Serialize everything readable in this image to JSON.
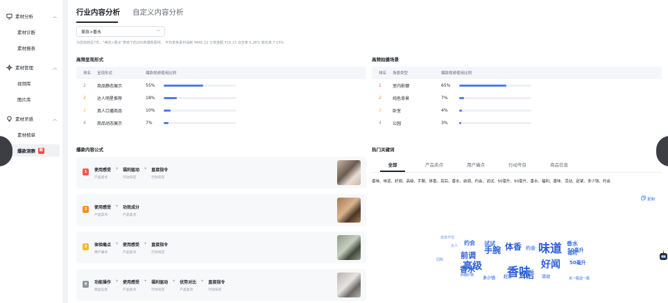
{
  "sidebar": {
    "groups": [
      {
        "label": "素材分析",
        "icon": "monitor-icon",
        "items": [
          "素材诊断",
          "素材报表"
        ]
      },
      {
        "label": "素材管理",
        "icon": "cross-icon",
        "items": [
          "视频库",
          "图片库"
        ]
      },
      {
        "label": "素材灵感",
        "icon": "bulb-icon",
        "items": [
          "素材榜单",
          "爆款洞察"
        ]
      }
    ],
    "active_item": "爆款洞察",
    "new_badge": "新"
  },
  "tabs": [
    "行业内容分析",
    "自定义内容分析"
  ],
  "filter": {
    "selected": "美妆>香水"
  },
  "summary": "为您找到近7天，\"美妆>香水\"类目下的200条爆款素材。  平均单条素材消耗 ¥845.22  订单金额 ¥10.13  点击率 5.26%  转化率 7.15%",
  "presentation": {
    "title": "高频呈现形式",
    "headers": [
      "排名",
      "呈现形式",
      "爆款视频使用比例"
    ],
    "rows": [
      {
        "rank": "1",
        "name": "商品静态展示",
        "pct": "55%",
        "value": 0.55
      },
      {
        "rank": "2",
        "name": "达人明星推荐",
        "pct": "18%",
        "value": 0.18
      },
      {
        "rank": "3",
        "name": "真人口播商品",
        "pct": "10%",
        "value": 0.1
      },
      {
        "rank": "4",
        "name": "商品动态展示",
        "pct": "7%",
        "value": 0.07
      }
    ]
  },
  "scene": {
    "title": "高频拍摄场景",
    "headers": [
      "排名",
      "场景类型",
      "爆款视频使用比例"
    ],
    "rows": [
      {
        "rank": "1",
        "name": "室内影棚",
        "pct": "65%",
        "value": 0.65
      },
      {
        "rank": "2",
        "name": "纯色背景",
        "pct": "7%",
        "value": 0.07
      },
      {
        "rank": "3",
        "name": "卧室",
        "pct": "4%",
        "value": 0.04
      },
      {
        "rank": "4",
        "name": "公园",
        "pct": "3%",
        "value": 0.03
      }
    ]
  },
  "formula": {
    "title": "爆款内容公式",
    "cards": [
      {
        "num": "1",
        "color": "#f5574a",
        "steps": [
          {
            "t": "使用感受",
            "s": "产品卖点"
          },
          {
            "t": "福利驱动",
            "s": "行动号召"
          },
          {
            "t": "直接指令",
            "s": "行动号召"
          }
        ]
      },
      {
        "num": "2",
        "color": "#f78c2b",
        "steps": [
          {
            "t": "使用感受",
            "s": "产品卖点"
          },
          {
            "t": "功效成分",
            "s": "产品卖点"
          }
        ]
      },
      {
        "num": "3",
        "color": "#f5b82e",
        "steps": [
          {
            "t": "体验痛点",
            "s": "用户痛点"
          },
          {
            "t": "使用感受",
            "s": "产品卖点"
          },
          {
            "t": "直接指令",
            "s": "行动号召"
          }
        ]
      },
      {
        "num": "4",
        "color": "#8f959e",
        "steps": [
          {
            "t": "功能操作",
            "s": "商品信息"
          },
          {
            "t": "使用感受",
            "s": "产品卖点"
          },
          {
            "t": "福利驱动",
            "s": "行动号召"
          },
          {
            "t": "优势对比",
            "s": "产品卖点"
          },
          {
            "t": "直接指令",
            "s": "行动号召"
          }
        ]
      }
    ]
  },
  "keywords": {
    "title": "热门关键词",
    "tabs": [
      "全部",
      "产品卖点",
      "用户痛点",
      "行动号召",
      "商品信息"
    ],
    "text": "香味、味道、好闻、高级、手腕、体香、耳后、香水、前调、约会、试试、50毫升、50毫升、香水、福利、香味、活动、赶紧、多少钱、约会",
    "copy_label": "复制",
    "cloud": [
      {
        "w": "香味",
        "size": 17,
        "color": "#2a5fd6"
      },
      {
        "w": "味道",
        "size": 17,
        "color": "#2a5fd6"
      },
      {
        "w": "高级",
        "size": 14,
        "color": "#2a5fd6"
      },
      {
        "w": "好闻",
        "size": 14,
        "color": "#2a5fd6"
      },
      {
        "w": "手腕",
        "size": 12,
        "color": "#2a5fd6"
      },
      {
        "w": "体香",
        "size": 12,
        "color": "#2a5fd6"
      },
      {
        "w": "香水",
        "size": 11,
        "color": "#2a5fd6"
      },
      {
        "w": "前调",
        "size": 11,
        "color": "#2a5fd6"
      },
      {
        "w": "耳后",
        "size": 11,
        "color": "#2a5fd6"
      },
      {
        "w": "约会",
        "size": 8,
        "color": "#3b6fe0"
      },
      {
        "w": "试试",
        "size": 8,
        "color": "#3b6fe0"
      },
      {
        "w": "香水",
        "size": 8,
        "color": "#3b6fe0"
      },
      {
        "w": "福利",
        "size": 7,
        "color": "#3b6fe0"
      },
      {
        "w": "50毫升",
        "size": 7,
        "color": "#3b6fe0"
      },
      {
        "w": "50毫升",
        "size": 7,
        "color": "#3b6fe0"
      },
      {
        "w": "约会",
        "size": 7,
        "color": "#5d8ae8"
      },
      {
        "w": "活动",
        "size": 6,
        "color": "#5d8ae8"
      },
      {
        "w": "香味",
        "size": 6,
        "color": "#5d8ae8"
      },
      {
        "w": "赶紧",
        "size": 6,
        "color": "#5d8ae8"
      },
      {
        "w": "多少钱",
        "size": 6,
        "color": "#5d8ae8"
      },
      {
        "w": "小样价格",
        "size": 5,
        "color": "#7da0ec"
      },
      {
        "w": "买一瓶送一瓶",
        "size": 5,
        "color": "#7da0ec"
      },
      {
        "w": "女人",
        "size": 5,
        "color": "#9db8f1"
      },
      {
        "w": "手腕",
        "size": 5,
        "color": "#9db8f1"
      },
      {
        "w": "回购",
        "size": 5,
        "color": "#9db8f1"
      },
      {
        "w": "念念不忘",
        "size": 5,
        "color": "#9db8f1"
      }
    ]
  }
}
